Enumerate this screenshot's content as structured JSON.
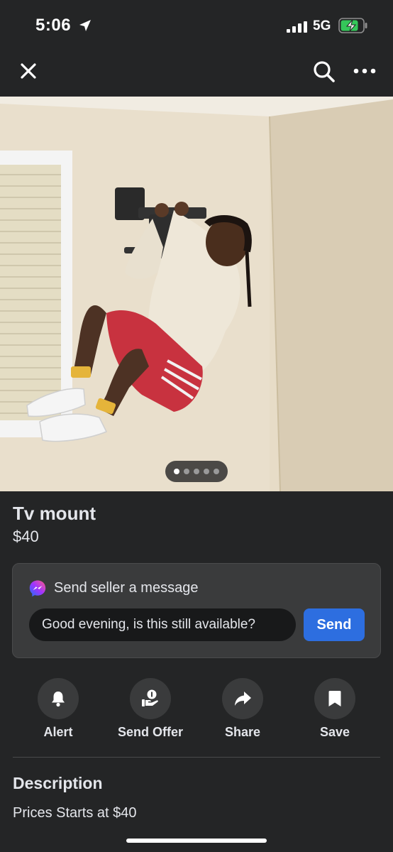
{
  "status_bar": {
    "time": "5:06",
    "network": "5G"
  },
  "nav": {
    "close_icon": "close-icon",
    "search_icon": "search-icon",
    "more_icon": "more-icon"
  },
  "listing": {
    "title": "Tv mount",
    "price": "$40",
    "photo_count": 5,
    "active_photo": 1
  },
  "message": {
    "heading": "Send seller a message",
    "input_value": "Good evening, is this still available?",
    "send_label": "Send"
  },
  "actions": [
    {
      "label": "Alert",
      "icon": "bell-icon"
    },
    {
      "label": "Send Offer",
      "icon": "offer-icon"
    },
    {
      "label": "Share",
      "icon": "share-icon"
    },
    {
      "label": "Save",
      "icon": "bookmark-icon"
    }
  ],
  "description": {
    "heading": "Description",
    "text": "Prices Starts at $40"
  },
  "colors": {
    "background": "#242526",
    "card": "#3a3b3c",
    "accent": "#2d6ee0"
  }
}
